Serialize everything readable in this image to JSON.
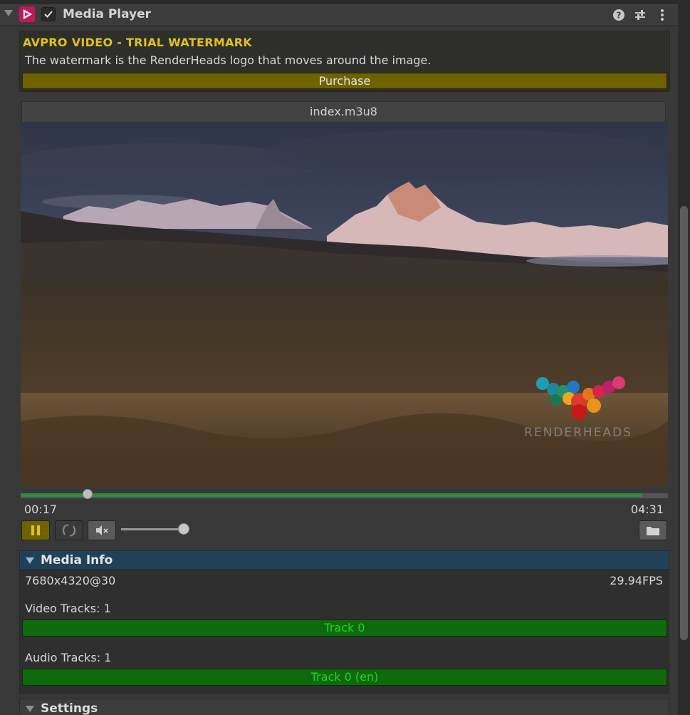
{
  "component": {
    "title": "Media Player",
    "enabled": true
  },
  "header_icons": [
    "help-icon",
    "preset-sliders-icon",
    "kebab-menu-icon"
  ],
  "watermark": {
    "title": "AVPRO VIDEO - TRIAL WATERMARK",
    "description": "The watermark is the RenderHeads logo that moves around the image.",
    "purchase_label": "Purchase"
  },
  "media": {
    "filename": "index.m3u8",
    "watermark_logo_text": "RENDERHEADS"
  },
  "playback": {
    "current_time": "00:17",
    "duration": "04:31",
    "progress_fraction": 0.072,
    "buffered_fraction": 0.96,
    "volume_fraction": 1.0,
    "state": "playing"
  },
  "controls": {
    "pause_icon": "pause-icon",
    "loop_icon": "loop-icon",
    "mute_icon": "mute-icon",
    "open_icon": "folder-icon"
  },
  "media_info": {
    "header": "Media Info",
    "resolution": "7680x4320@30",
    "fps": "29.94FPS",
    "video_tracks_label": "Video Tracks: 1",
    "video_tracks": [
      "Track 0"
    ],
    "audio_tracks_label": "Audio Tracks: 1",
    "audio_tracks": [
      "Track 0 (en)"
    ]
  },
  "settings": {
    "header": "Settings"
  },
  "colors": {
    "accent_yellow": "#e0c21a",
    "purchase_bg": "#6e6200",
    "track_green_bg": "#0f6a0d",
    "track_green_text": "#1ed81e",
    "info_header_bg": "#1f4258",
    "timeline_buffer": "#2e8c3a"
  }
}
